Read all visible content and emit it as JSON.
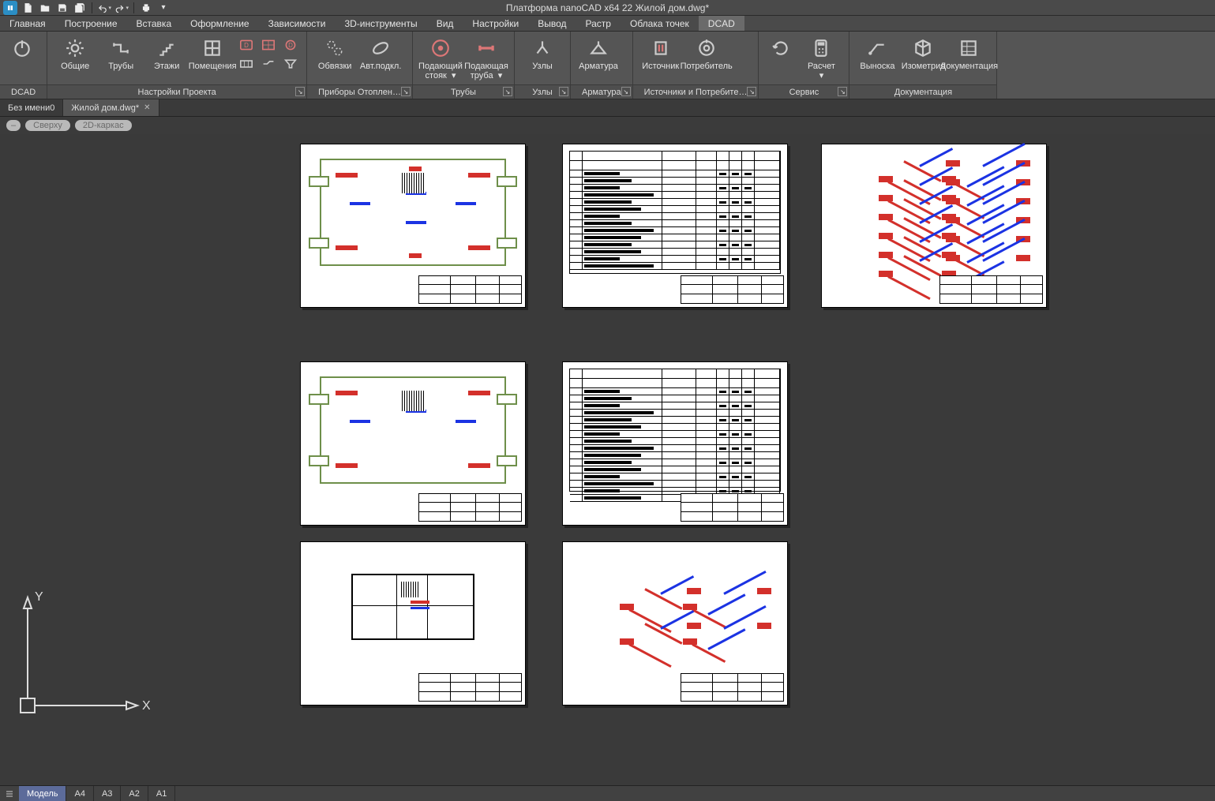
{
  "app": {
    "title": "Платформа nanoCAD x64 22 Жилой дом.dwg*",
    "qat_icons": [
      "new-file-icon",
      "open-file-icon",
      "save-icon",
      "save-all-icon",
      "undo-icon",
      "redo-icon",
      "print-icon",
      "overflow-icon"
    ]
  },
  "menutabs": [
    "Главная",
    "Построение",
    "Вставка",
    "Оформление",
    "Зависимости",
    "3D-инструменты",
    "Вид",
    "Настройки",
    "Вывод",
    "Растр",
    "Облака точек",
    "DCAD"
  ],
  "menutab_active": "DCAD",
  "ribbon": {
    "groups": [
      {
        "id": "dcad",
        "title": "DCAD",
        "launcher": false,
        "buttons": [
          {
            "icon": "power-icon",
            "label": ""
          }
        ]
      },
      {
        "id": "project",
        "title": "Настройки Проекта",
        "launcher": true,
        "buttons": [
          {
            "icon": "gear-icon",
            "label": "Общие"
          },
          {
            "icon": "pipes-icon",
            "label": "Трубы"
          },
          {
            "icon": "stairs-icon",
            "label": "Этажи"
          },
          {
            "icon": "rooms-icon",
            "label": "Помещения"
          }
        ],
        "smallcols": [
          [
            "heater-d-icon",
            "wall-icon"
          ],
          [
            "grid-d-icon",
            "duct-icon"
          ],
          [
            "filter-d-icon",
            "funnel-icon"
          ]
        ]
      },
      {
        "id": "radiators",
        "title": "Приборы Отоплен…",
        "launcher": true,
        "buttons": [
          {
            "icon": "binding-icon",
            "label": "Обвязки"
          },
          {
            "icon": "autopick-icon",
            "label": "Авт.подкл."
          }
        ]
      },
      {
        "id": "pipes",
        "title": "Трубы",
        "launcher": true,
        "buttons": [
          {
            "icon": "riser-icon",
            "label": "Подающий\nстояк  ▾"
          },
          {
            "icon": "supply-pipe-icon",
            "label": "Подающая\nтруба  ▾"
          }
        ]
      },
      {
        "id": "nodes",
        "title": "Узлы",
        "launcher": true,
        "buttons": [
          {
            "icon": "node-icon",
            "label": "Узлы"
          }
        ]
      },
      {
        "id": "fittings",
        "title": "Арматура",
        "launcher": true,
        "buttons": [
          {
            "icon": "valve-icon",
            "label": "Арматура"
          }
        ]
      },
      {
        "id": "sources",
        "title": "Источники и Потребите…",
        "launcher": true,
        "buttons": [
          {
            "icon": "source-icon",
            "label": "Источник"
          },
          {
            "icon": "consumer-icon",
            "label": "Потребитель"
          }
        ]
      },
      {
        "id": "service",
        "title": "Сервис",
        "launcher": true,
        "buttons": [
          {
            "icon": "refresh-icon",
            "label": ""
          },
          {
            "icon": "calc-icon",
            "label": "Расчет\n▾"
          }
        ]
      },
      {
        "id": "docs",
        "title": "Документация",
        "launcher": false,
        "buttons": [
          {
            "icon": "leader-icon",
            "label": "Выноска"
          },
          {
            "icon": "isometry-icon",
            "label": "Изометрия"
          },
          {
            "icon": "table-icon",
            "label": "Документация"
          }
        ]
      }
    ]
  },
  "doctabs": [
    {
      "label": "Без имени0",
      "active": false,
      "closeable": false
    },
    {
      "label": "Жилой дом.dwg*",
      "active": true,
      "closeable": true
    }
  ],
  "viewpills": [
    "–",
    "Сверху",
    "2D-каркас"
  ],
  "ucs": {
    "x": "X",
    "y": "Y"
  },
  "layouttabs": [
    "Модель",
    "A4",
    "A3",
    "A2",
    "A1"
  ],
  "layouttab_active": "Модель"
}
